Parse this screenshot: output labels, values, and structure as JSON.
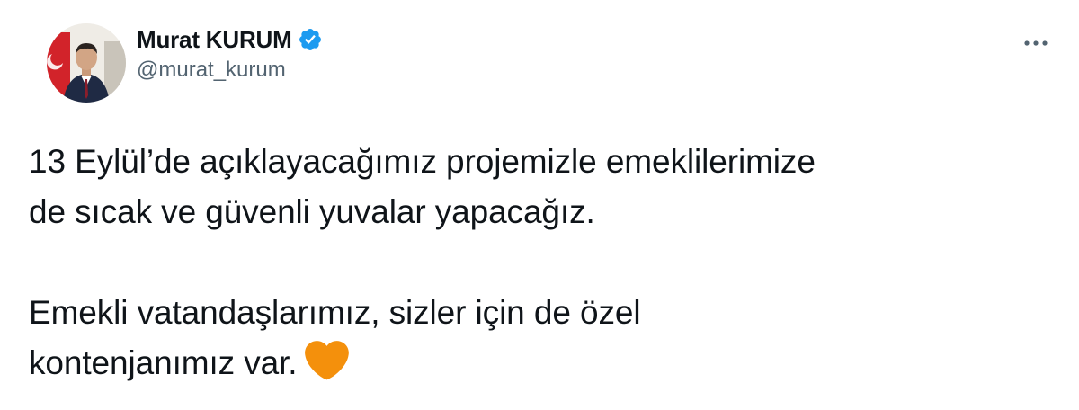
{
  "author": {
    "display_name": "Murat KURUM",
    "handle": "@murat_kurum",
    "verified": true,
    "verified_color": "#1d9bf0"
  },
  "tweet": {
    "lines": [
      "13 Eylül’de açıklayacağımız projemizle emeklilerimize",
      "de sıcak ve güvenli yuvalar yapacağız.",
      "Emekli vatandaşlarımız, sizler için de özel",
      "kontenjanımız var."
    ],
    "emoji": "orange-heart",
    "emoji_color": "#f4900c"
  },
  "icons": {
    "more": "more-horizontal-icon",
    "verified": "verified-badge-icon"
  }
}
